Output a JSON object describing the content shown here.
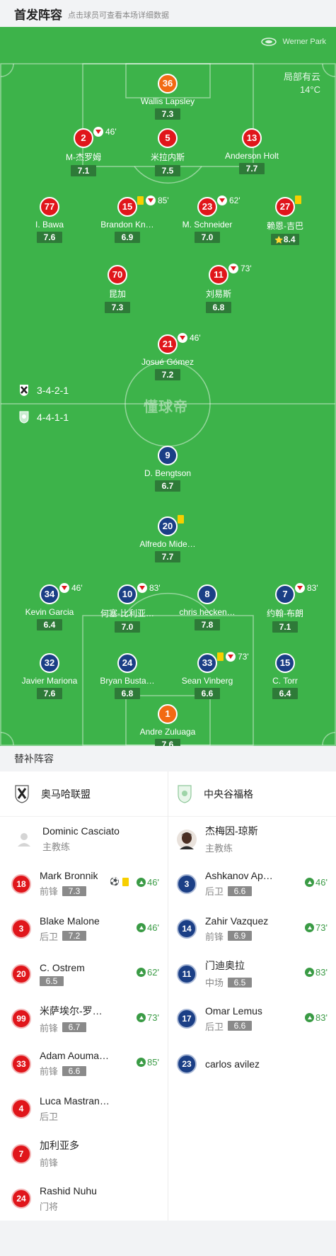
{
  "header": {
    "title": "首发阵容",
    "hint": "点击球员可查看本场详细数据"
  },
  "venue": {
    "name": "Werner Park",
    "icon": "stadium-icon"
  },
  "weather": {
    "condition": "局部有云",
    "temp": "14°C"
  },
  "watermark": "懂球帝",
  "formations": {
    "home": "3-4-2-1",
    "away": "4-4-1-1"
  },
  "colors": {
    "home": "#e0161b",
    "away": "#1b3f86",
    "gk": "#f26a13",
    "pitch": "#3db34a"
  },
  "home_lineup": [
    {
      "num": "36",
      "name": "Wallis Lapsley",
      "rating": "7.3",
      "gk": true
    },
    {
      "num": "2",
      "name": "M-杰罗姆",
      "rating": "7.1",
      "sub_out": "46'"
    },
    {
      "num": "5",
      "name": "米拉内斯",
      "rating": "7.5",
      "captain": true
    },
    {
      "num": "13",
      "name": "Anderson Holt",
      "rating": "7.7"
    },
    {
      "num": "77",
      "name": "I. Bawa",
      "rating": "7.6"
    },
    {
      "num": "15",
      "name": "Brandon Kn…",
      "rating": "6.9",
      "yellow": true,
      "sub_out": "85'"
    },
    {
      "num": "23",
      "name": "M. Schneider",
      "rating": "7.0",
      "sub_out": "62'"
    },
    {
      "num": "27",
      "name": "赖恩-吉巴",
      "rating": "8.4",
      "yellow": true,
      "goal": true,
      "assist": true,
      "best": true
    },
    {
      "num": "70",
      "name": "昆加",
      "rating": "7.3"
    },
    {
      "num": "11",
      "name": "刘易斯",
      "rating": "6.8",
      "sub_out": "73'"
    },
    {
      "num": "21",
      "name": "Josué Gómez",
      "rating": "7.2",
      "sub_out": "46'",
      "goal": true
    }
  ],
  "away_lineup": [
    {
      "num": "9",
      "name": "D. Bengtson",
      "rating": "6.7"
    },
    {
      "num": "20",
      "name": "Alfredo Mide…",
      "rating": "7.7",
      "yellow": true
    },
    {
      "num": "34",
      "name": "Kevin Garcia",
      "rating": "6.4",
      "sub_out": "46'"
    },
    {
      "num": "10",
      "name": "何塞-比利亚…",
      "rating": "7.0",
      "sub_out": "83'"
    },
    {
      "num": "8",
      "name": "chris hecken…",
      "rating": "7.8",
      "captain": true
    },
    {
      "num": "7",
      "name": "约翰-布朗",
      "rating": "7.1",
      "sub_out": "83'"
    },
    {
      "num": "32",
      "name": "Javier Mariona",
      "rating": "7.6",
      "goal": true
    },
    {
      "num": "24",
      "name": "Bryan Busta…",
      "rating": "6.8"
    },
    {
      "num": "33",
      "name": "Sean Vinberg",
      "rating": "6.6",
      "yellow": true,
      "sub_out": "73'"
    },
    {
      "num": "15",
      "name": "C. Torr",
      "rating": "6.4"
    },
    {
      "num": "1",
      "name": "Andre Zuluaga",
      "rating": "7.6",
      "gk": true
    }
  ],
  "bench": {
    "title": "替补阵容",
    "home": {
      "team": "奥马哈联盟",
      "coach": {
        "name": "Dominic Casciato",
        "role": "主教练"
      },
      "players": [
        {
          "num": "18",
          "name": "Mark Bronnik",
          "pos": "前锋",
          "rating": "7.3",
          "sub_in": "46'",
          "goal": true,
          "yellow": true
        },
        {
          "num": "3",
          "name": "Blake Malone",
          "pos": "后卫",
          "rating": "7.2",
          "sub_in": "46'"
        },
        {
          "num": "20",
          "name": "C. Ostrem",
          "pos": "",
          "rating": "6.5",
          "sub_in": "62'"
        },
        {
          "num": "99",
          "name": "米萨埃尔-罗…",
          "pos": "前锋",
          "rating": "6.7",
          "sub_in": "73'"
        },
        {
          "num": "33",
          "name": "Adam Aouma…",
          "pos": "前锋",
          "rating": "6.6",
          "sub_in": "85'"
        },
        {
          "num": "4",
          "name": "Luca Mastran…",
          "pos": "后卫",
          "rating": "",
          "sub_in": ""
        },
        {
          "num": "7",
          "name": "加利亚多",
          "pos": "前锋",
          "rating": "",
          "sub_in": ""
        },
        {
          "num": "24",
          "name": "Rashid Nuhu",
          "pos": "门将",
          "rating": "",
          "sub_in": ""
        }
      ]
    },
    "away": {
      "team": "中央谷福格",
      "coach": {
        "name": "杰梅因-琼斯",
        "role": "主教练"
      },
      "players": [
        {
          "num": "3",
          "name": "Ashkanov Ap…",
          "pos": "后卫",
          "rating": "6.6",
          "sub_in": "46'"
        },
        {
          "num": "14",
          "name": "Zahir Vazquez",
          "pos": "前锋",
          "rating": "6.9",
          "sub_in": "73'"
        },
        {
          "num": "11",
          "name": "门迪奥拉",
          "pos": "中场",
          "rating": "6.5",
          "sub_in": "83'"
        },
        {
          "num": "17",
          "name": "Omar Lemus",
          "pos": "后卫",
          "rating": "6.6",
          "sub_in": "83'"
        },
        {
          "num": "23",
          "name": "carlos avilez",
          "pos": "",
          "rating": "",
          "sub_in": ""
        }
      ]
    }
  }
}
